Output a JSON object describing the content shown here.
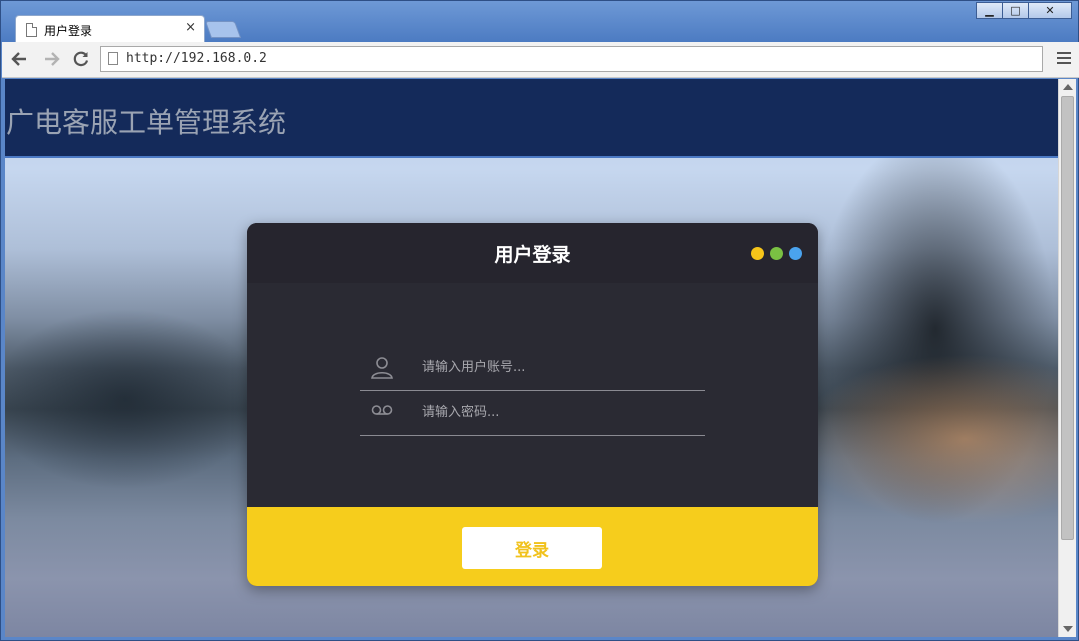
{
  "browser": {
    "tab_title": "用户登录",
    "tab_close": "×",
    "url": "http://192.168.0.2",
    "icons": {
      "back": "back-arrow-icon",
      "forward": "forward-arrow-icon",
      "reload": "reload-icon",
      "menu": "menu-icon"
    }
  },
  "window_controls": {
    "minimize": "▁",
    "maximize": "□",
    "close": "✕"
  },
  "site": {
    "title": "广电客服工单管理系统",
    "header_color": "#142a5a"
  },
  "login": {
    "title": "用户登录",
    "username_placeholder": "请输入用户账号...",
    "password_placeholder": "请输入密码...",
    "submit_label": "登录",
    "dot_colors": [
      "#f6c51a",
      "#7ac143",
      "#4aa3ee"
    ],
    "accent_color": "#f6cd1c"
  }
}
